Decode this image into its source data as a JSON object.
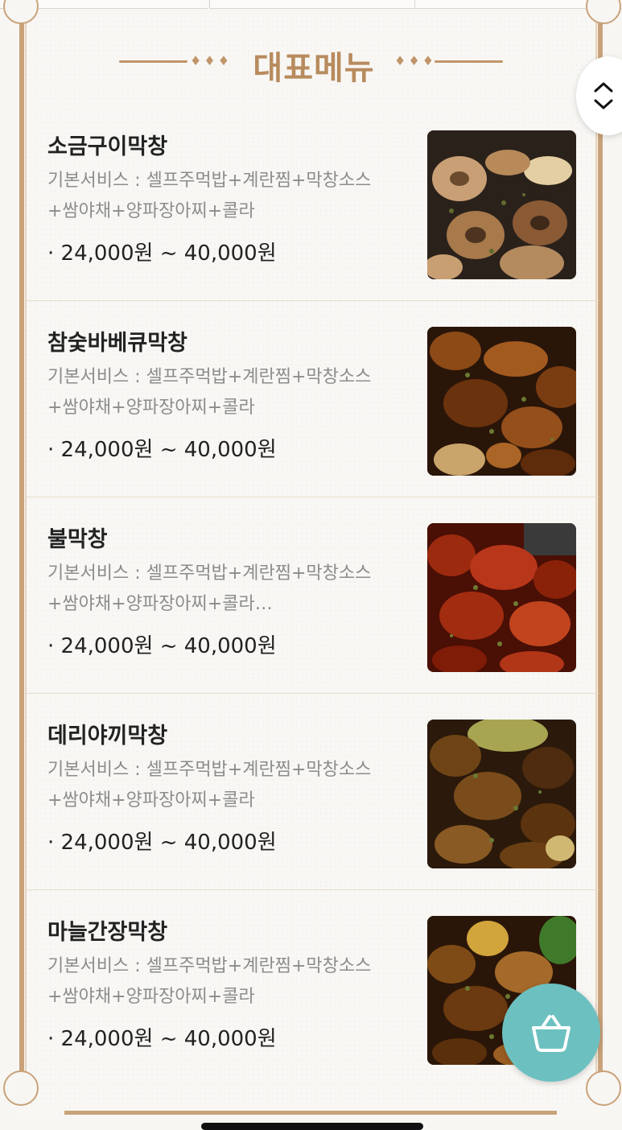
{
  "header": {
    "title": "대표메뉴",
    "ornament_left": "♦♦♦",
    "ornament_right": "♦♦♦"
  },
  "menu": [
    {
      "name": "소금구이막창",
      "desc": "기본서비스 : 셀프주먹밥+계란찜+막창소스+쌈야채+양파장아찌+콜라",
      "price": "· 24,000원 ~ 40,000원",
      "image": "grilled-salt-makchang"
    },
    {
      "name": "참숯바베큐막창",
      "desc": "기본서비스 : 셀프주먹밥+계란찜+막창소스+쌈야채+양파장아찌+콜라",
      "price": "· 24,000원 ~ 40,000원",
      "image": "charcoal-bbq-makchang"
    },
    {
      "name": "불막창",
      "desc": "기본서비스 : 셀프주먹밥+계란찜+막창소스+쌈야채+양파장아찌+콜라…",
      "price": "· 24,000원 ~ 40,000원",
      "image": "spicy-fire-makchang"
    },
    {
      "name": "데리야끼막창",
      "desc": "기본서비스 : 셀프주먹밥+계란찜+막창소스+쌈야채+양파장아찌+콜라",
      "price": "· 24,000원 ~ 40,000원",
      "image": "teriyaki-makchang"
    },
    {
      "name": "마늘간장막창",
      "desc": "기본서비스 : 셀프주먹밥+계란찜+막창소스+쌈야채+양파장아찌+콜라",
      "price": "· 24,000원 ~ 40,000원",
      "image": "garlic-soy-makchang"
    }
  ],
  "icons": {
    "scroll": "chevron-up-down-icon",
    "cart": "shopping-basket-icon"
  },
  "colors": {
    "accent": "#b88b5e",
    "frame": "#c9a27a",
    "cart": "#6cc1c0"
  }
}
